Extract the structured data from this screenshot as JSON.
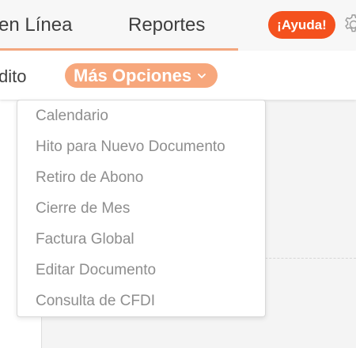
{
  "topnav": {
    "items": [
      {
        "label": "en Línea"
      },
      {
        "label": "Reportes"
      }
    ],
    "help_label": "¡Ayuda!",
    "settings_icon": "gear-icon",
    "colors": {
      "accent": "#f4511e",
      "underline": "#f3a77f"
    }
  },
  "subnav": {
    "partial_label": "dito",
    "more_options_label": "Más Opciones",
    "more_options_icon": "chevron-down-icon",
    "more_options_color": "#f7a77c"
  },
  "dropdown": {
    "items": [
      {
        "label": "Calendario"
      },
      {
        "label": "Hito para Nuevo Documento"
      },
      {
        "label": "Retiro de Abono"
      },
      {
        "label": "Cierre de Mes"
      },
      {
        "label": "Factura Global"
      },
      {
        "label": "Editar Documento"
      },
      {
        "label": "Consulta de CFDI"
      }
    ]
  }
}
